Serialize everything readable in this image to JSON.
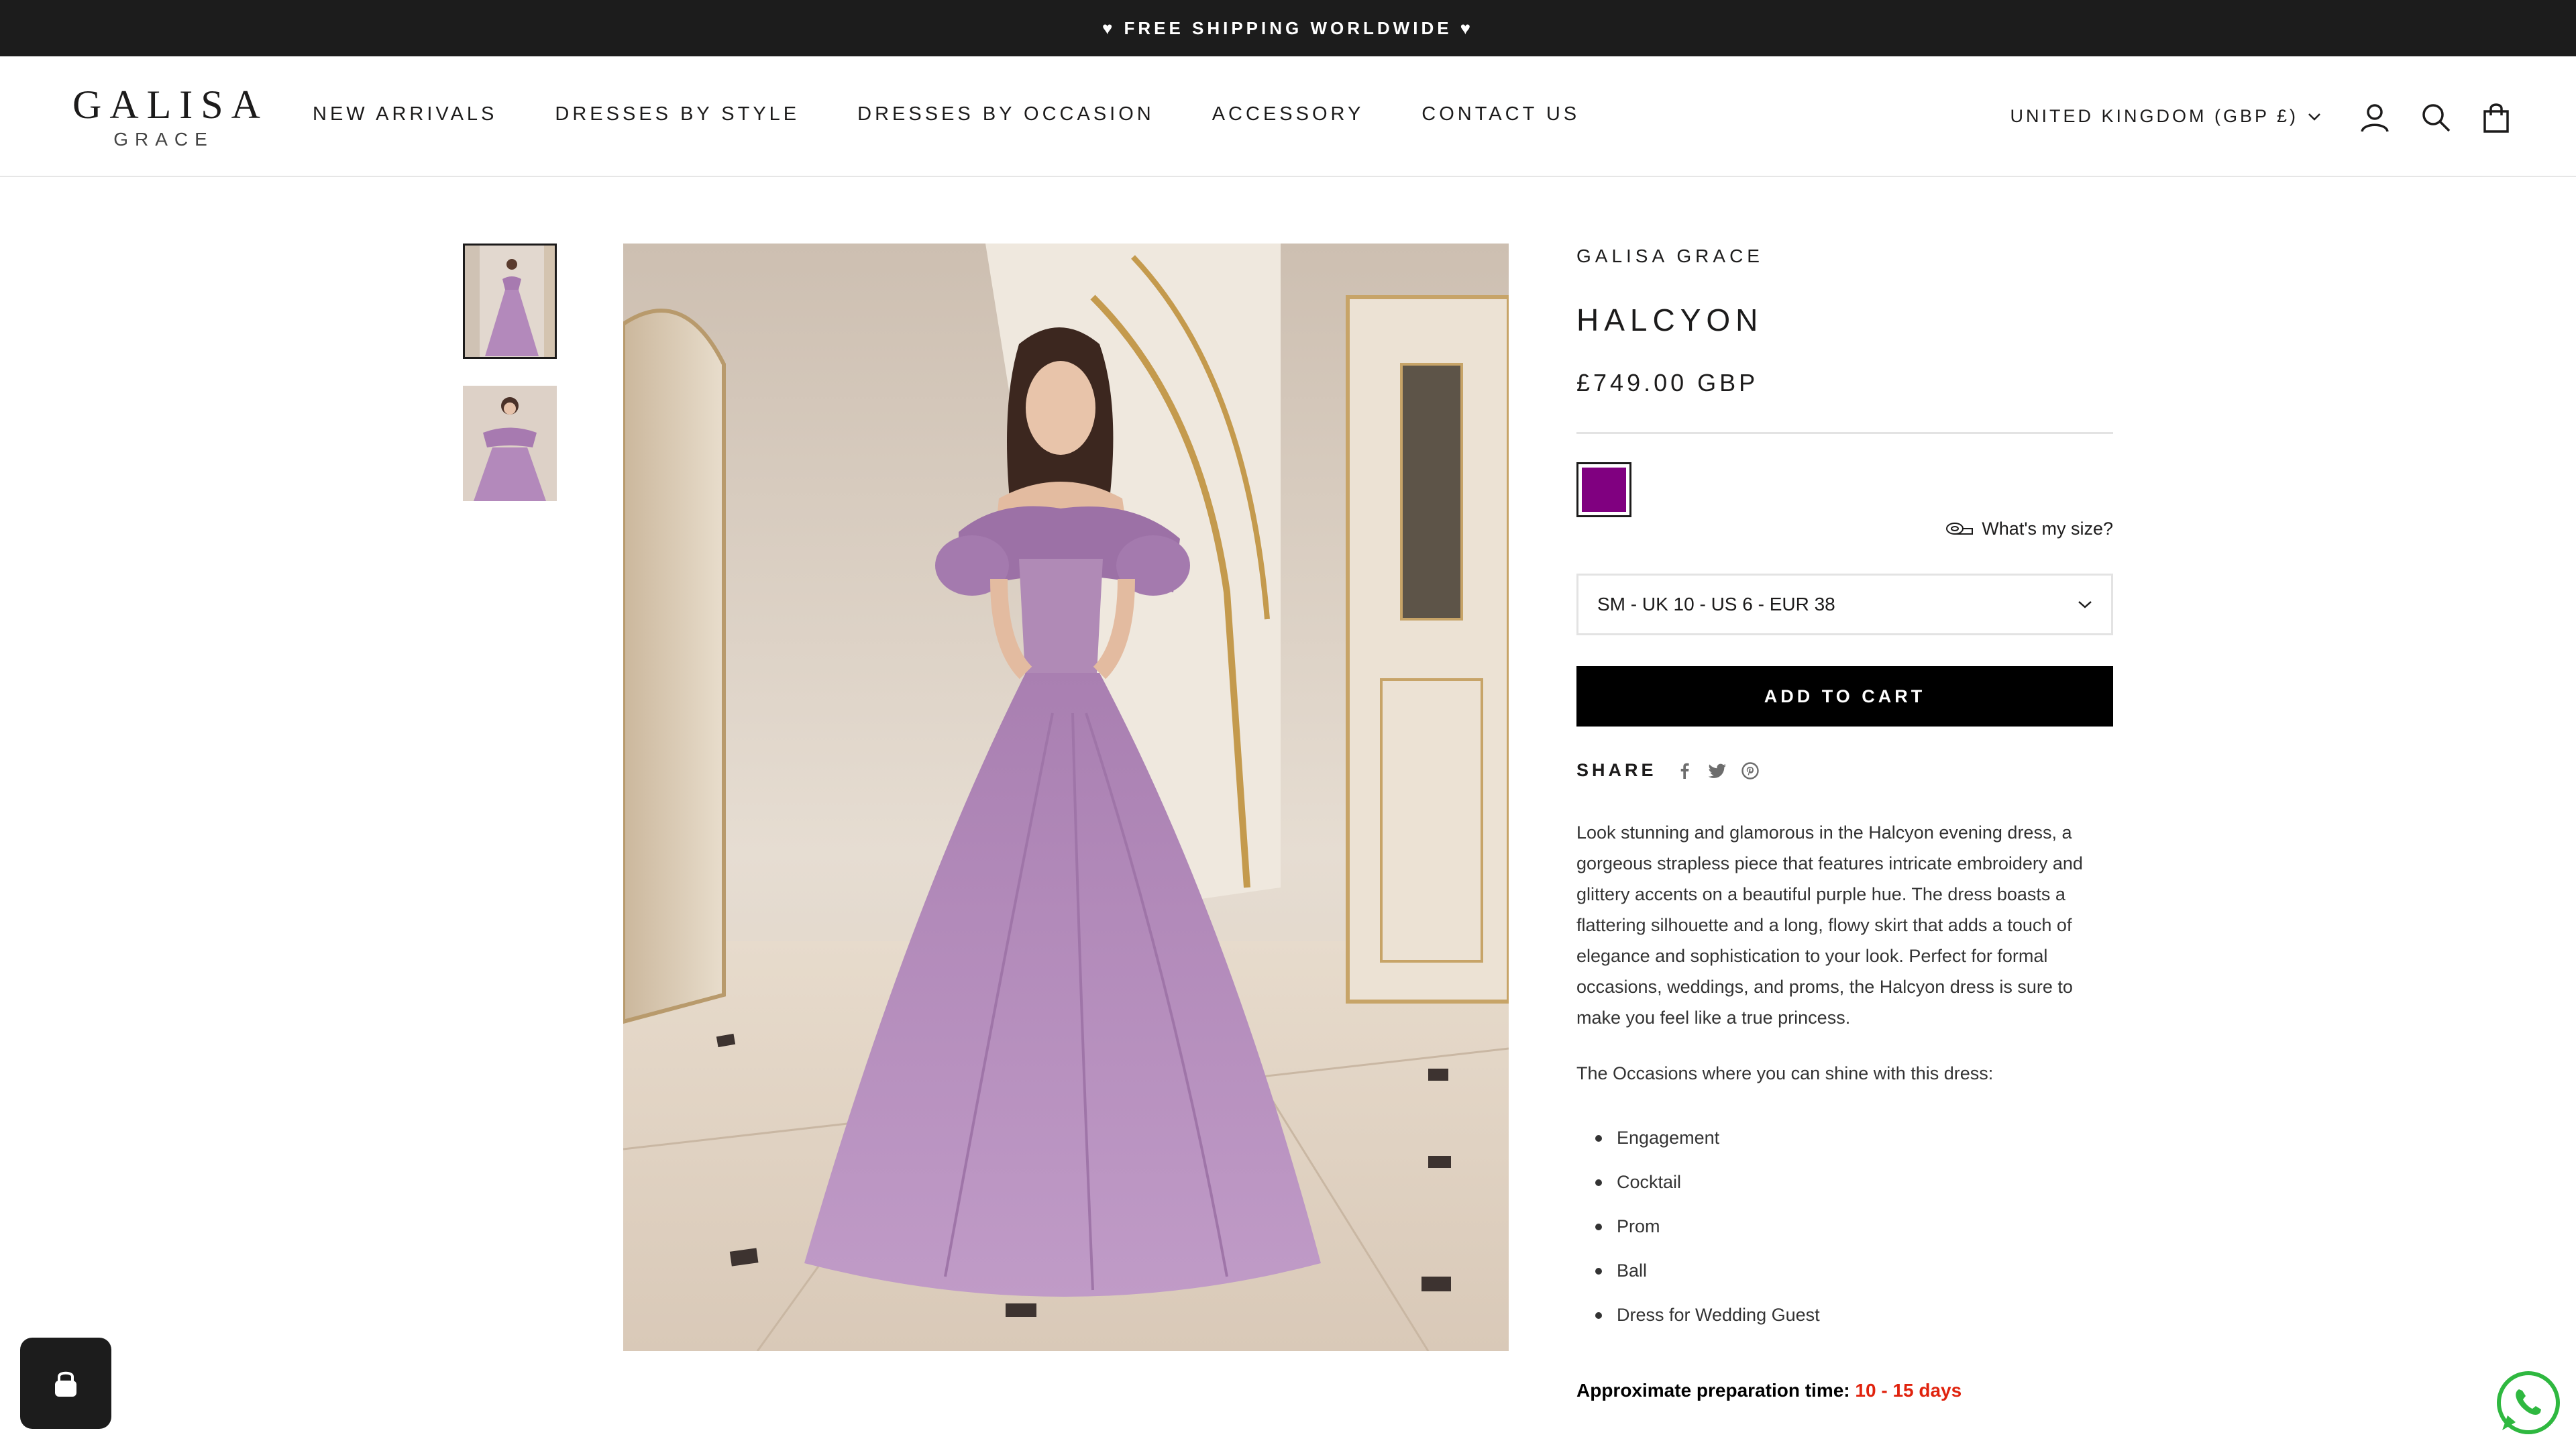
{
  "announcement": {
    "text": "FREE SHIPPING WORLDWIDE",
    "icon": "heart-icon"
  },
  "header": {
    "logo_main": "GALISA",
    "logo_sub": "GRACE",
    "nav": [
      "NEW ARRIVALS",
      "DRESSES BY STYLE",
      "DRESSES BY OCCASION",
      "ACCESSORY",
      "CONTACT US"
    ],
    "country": "UNITED KINGDOM (GBP £)",
    "icons": [
      "account-icon",
      "search-icon",
      "cart-icon"
    ]
  },
  "gallery": {
    "thumbnail_count": 2,
    "active_index": 0
  },
  "product": {
    "vendor": "GALISA GRACE",
    "title": "HALCYON",
    "price": "£749.00 GBP",
    "swatch_color": "#800080",
    "size_help": "What's my size?",
    "size_selected": "SM - UK 10 - US 6 - EUR 38",
    "add_to_cart": "ADD TO CART",
    "share_label": "SHARE",
    "description": "Look stunning and glamorous in the Halcyon evening dress, a gorgeous strapless piece that features intricate embroidery and glittery accents on a beautiful purple hue. The dress boasts a flattering silhouette and a long, flowy skirt that adds a touch of elegance and sophistication to your look. Perfect for formal occasions, weddings, and proms, the Halcyon dress is sure to make you feel like a true princess.",
    "occasions_intro": "The Occasions where you can shine with this dress:",
    "occasions": [
      "Engagement",
      "Cocktail",
      "Prom",
      "Ball",
      "Dress for Wedding Guest"
    ],
    "prep_label": "Approximate preparation time:",
    "prep_value": "10 - 15 days"
  },
  "colors": {
    "accent": "#800080",
    "prep_highlight": "#e0220d",
    "bar": "#1c1c1c"
  }
}
